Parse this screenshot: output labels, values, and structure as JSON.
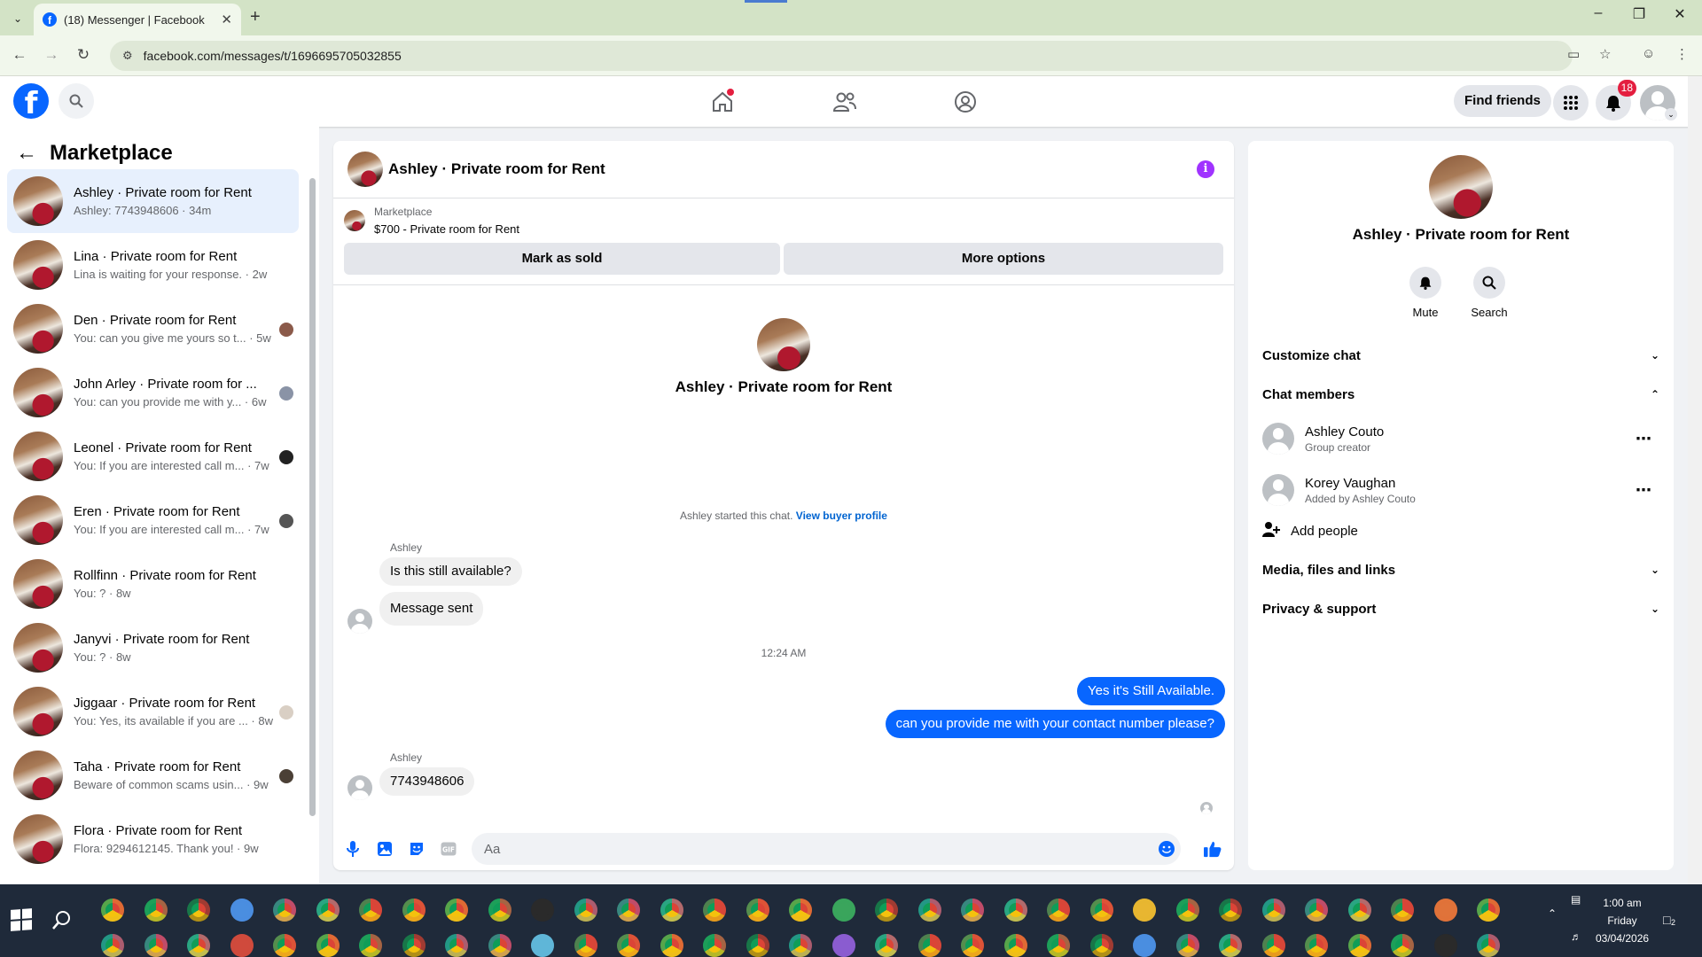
{
  "browser": {
    "tab_title": "(18) Messenger | Facebook",
    "url": "facebook.com/messages/t/1696695705032855"
  },
  "fb": {
    "find_friends": "Find friends",
    "notifications_count": "18",
    "brand_color": "#0866ff"
  },
  "sidebar": {
    "title": "Marketplace",
    "conversations": [
      {
        "name": "Ashley · Private room for Rent",
        "sub": "Ashley: 7743948606 · 34m",
        "active": true
      },
      {
        "name": "Lina · Private room for Rent",
        "sub": "Lina is waiting for your response. · 2w"
      },
      {
        "name": "Den · Private room for Rent",
        "sub": "You: can you give me yours so t... · 5w"
      },
      {
        "name": "John Arley · Private room for ...",
        "sub": "You: can you provide me with y... · 6w"
      },
      {
        "name": "Leonel · Private room for Rent",
        "sub": "You: If you are interested call m... · 7w"
      },
      {
        "name": "Eren · Private room for Rent",
        "sub": "You: If you are interested call m... · 7w"
      },
      {
        "name": "Rollfinn · Private room for Rent",
        "sub": "You: ? · 8w"
      },
      {
        "name": "Janyvi · Private room for Rent",
        "sub": "You: ? · 8w"
      },
      {
        "name": "Jiggaar · Private room for Rent",
        "sub": "You: Yes, its available if you are ... · 8w"
      },
      {
        "name": "Taha · Private room for Rent",
        "sub": "Beware of common scams usin... · 9w"
      },
      {
        "name": "Flora · Private room for Rent",
        "sub": "Flora: 9294612145. Thank you! · 9w"
      }
    ]
  },
  "chat": {
    "header_name": "Ashley · Private room for Rent",
    "marketplace_label": "Marketplace",
    "listing": "$700 - Private room for Rent",
    "mark_sold": "Mark as sold",
    "more_options": "More options",
    "intro_name": "Ashley · Private room for Rent",
    "started_text": "Ashley started this chat.",
    "view_buyer": "View buyer profile",
    "sender1": "Ashley",
    "msg1": "Is this still available?",
    "msg2": "Message sent",
    "time": "12:24 AM",
    "out1": "Yes it's Still Available.",
    "out2": "can you provide me with your contact number please?",
    "sender2": "Ashley",
    "msg3": "7743948606",
    "input_placeholder": "Aa"
  },
  "details": {
    "name": "Ashley · Private room for Rent",
    "mute": "Mute",
    "search": "Search",
    "customize": "Customize chat",
    "members_title": "Chat members",
    "members": [
      {
        "name": "Ashley Couto",
        "role": "Group creator"
      },
      {
        "name": "Korey Vaughan",
        "role": "Added by Ashley Couto"
      }
    ],
    "add_people": "Add people",
    "media": "Media, files and links",
    "privacy": "Privacy & support"
  },
  "taskbar": {
    "time": "1:00 am",
    "day": "Friday",
    "date": "03/04/2026",
    "notif": "2"
  }
}
